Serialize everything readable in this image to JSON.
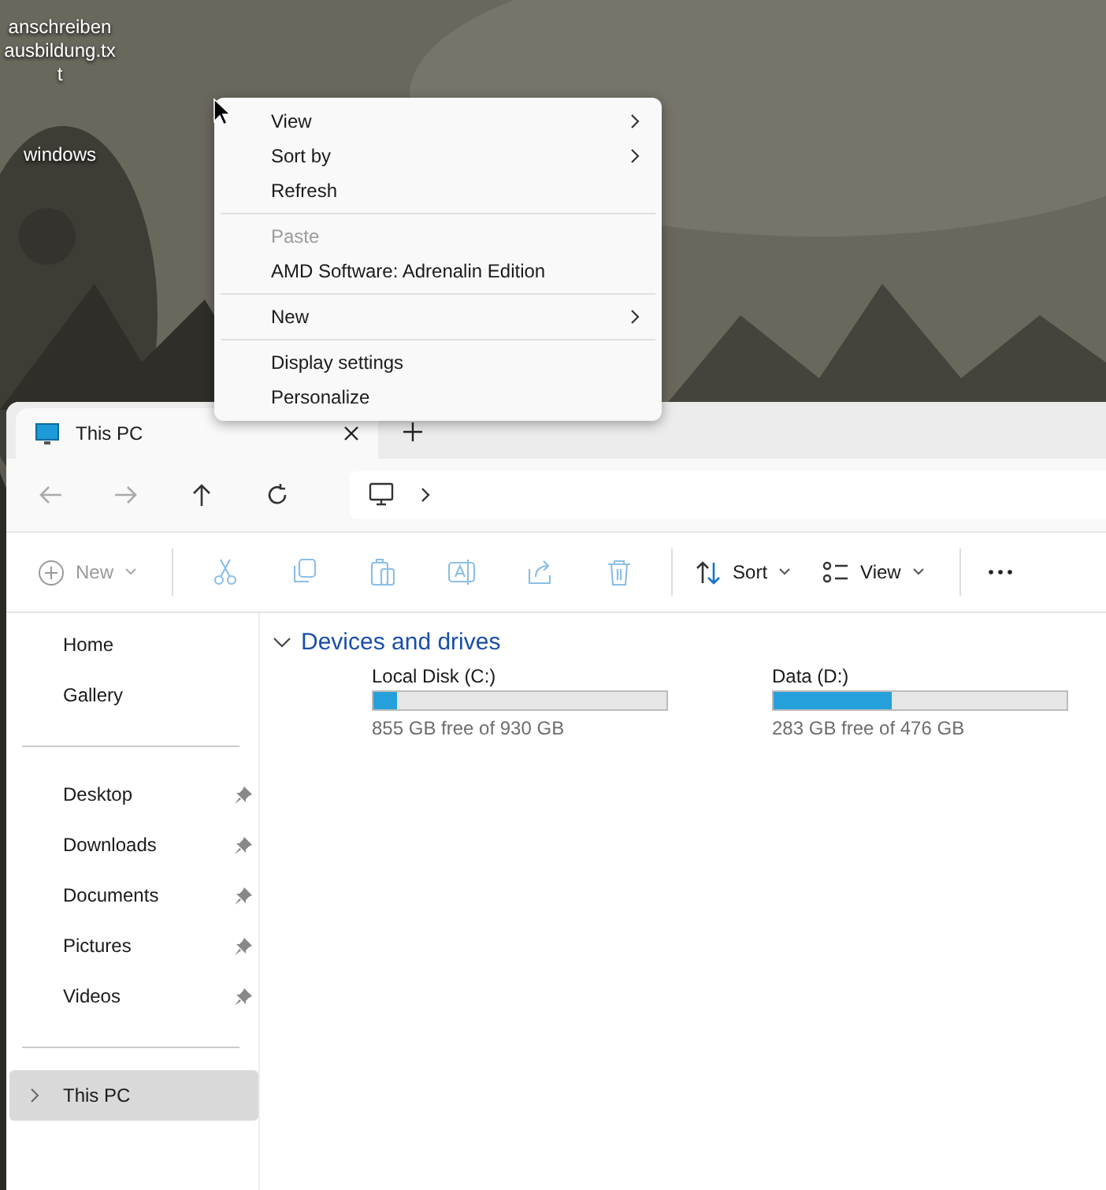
{
  "desktop": {
    "icons": [
      {
        "label": "anschreiben ausbildung.tx t"
      },
      {
        "label": "windows"
      }
    ]
  },
  "context_menu": {
    "groups": [
      [
        {
          "label": "View",
          "submenu": true,
          "disabled": false
        },
        {
          "label": "Sort by",
          "submenu": true,
          "disabled": false
        },
        {
          "label": "Refresh",
          "submenu": false,
          "disabled": false
        }
      ],
      [
        {
          "label": "Paste",
          "submenu": false,
          "disabled": true
        },
        {
          "label": "AMD Software: Adrenalin Edition",
          "submenu": false,
          "disabled": false
        }
      ],
      [
        {
          "label": "New",
          "submenu": true,
          "disabled": false
        }
      ],
      [
        {
          "label": "Display settings",
          "submenu": false,
          "disabled": false
        },
        {
          "label": "Personalize",
          "submenu": false,
          "disabled": false
        }
      ]
    ]
  },
  "explorer": {
    "tabs": [
      {
        "label": "This PC",
        "selected": true
      }
    ],
    "nav_buttons": [
      {
        "kind": "back",
        "disabled": true
      },
      {
        "kind": "forward",
        "disabled": true
      },
      {
        "kind": "up",
        "disabled": false
      },
      {
        "kind": "refresh",
        "disabled": false
      }
    ],
    "toolbar": [
      {
        "kind": "new",
        "label": "New",
        "disabled": true
      },
      {
        "kind": "cut",
        "disabled": true
      },
      {
        "kind": "copy",
        "disabled": true
      },
      {
        "kind": "paste",
        "disabled": true
      },
      {
        "kind": "rename",
        "disabled": true
      },
      {
        "kind": "share",
        "disabled": true
      },
      {
        "kind": "delete",
        "disabled": true
      },
      {
        "kind": "sort",
        "label": "Sort",
        "disabled": false
      },
      {
        "kind": "view",
        "label": "View",
        "disabled": false
      },
      {
        "kind": "more"
      }
    ],
    "sidebar": {
      "sections": [
        [
          {
            "label": "Home",
            "pinned": false,
            "selected": false,
            "expandable": false
          },
          {
            "label": "Gallery",
            "pinned": false,
            "selected": false,
            "expandable": false
          }
        ],
        [
          {
            "label": "Desktop",
            "pinned": true,
            "selected": false,
            "expandable": false
          },
          {
            "label": "Downloads",
            "pinned": true,
            "selected": false,
            "expandable": false
          },
          {
            "label": "Documents",
            "pinned": true,
            "selected": false,
            "expandable": false
          },
          {
            "label": "Pictures",
            "pinned": true,
            "selected": false,
            "expandable": false
          },
          {
            "label": "Videos",
            "pinned": true,
            "selected": false,
            "expandable": false
          }
        ],
        [
          {
            "label": "This PC",
            "pinned": false,
            "selected": true,
            "expandable": true
          }
        ]
      ]
    },
    "group": {
      "title": "Devices and drives",
      "expanded": true,
      "drives": [
        {
          "name": "Local Disk (C:)",
          "level": 0.08,
          "free": "855 GB free of 930 GB"
        },
        {
          "name": "Data (D:)",
          "level": 0.405,
          "free": "283 GB free of 476 GB"
        }
      ]
    }
  }
}
